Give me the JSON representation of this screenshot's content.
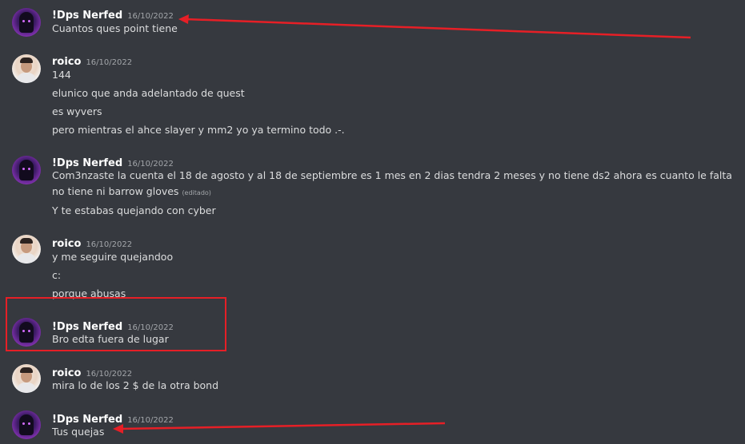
{
  "messages": [
    {
      "author": "!Dps Nerfed",
      "timestamp": "16/10/2022",
      "lines": [
        "Cuantos ques point tiene"
      ]
    },
    {
      "author": "roico",
      "timestamp": "16/10/2022",
      "lines": [
        "144",
        "elunico que anda adelantado de quest",
        "es wyvers",
        "pero mientras el ahce slayer y mm2 yo ya termino todo .-."
      ]
    },
    {
      "author": "!Dps Nerfed",
      "timestamp": "16/10/2022",
      "lines": [
        "Com3nzaste la cuenta el 18 de agosto y al 18 de septiembre es 1 mes en 2 dias tendra 2 meses y no  tiene ds2 ahora es cuanto le falta no tiene ni barrow gloves",
        "Y te estabas quejando con cyber"
      ],
      "edited_label": "(editado)"
    },
    {
      "author": "roico",
      "timestamp": "16/10/2022",
      "lines": [
        "y me seguire quejandoo",
        "c:",
        "porque abusas"
      ]
    },
    {
      "author": "!Dps Nerfed",
      "timestamp": "16/10/2022",
      "lines": [
        "Bro edta fuera de lugar"
      ]
    },
    {
      "author": "roico",
      "timestamp": "16/10/2022",
      "lines": [
        "mira lo de los 2 $ de la otra bond"
      ]
    },
    {
      "author": "!Dps Nerfed",
      "timestamp": "16/10/2022",
      "lines": [
        "Tus quejas"
      ]
    }
  ],
  "annotation_color": "#e61f26",
  "icons": {
    "dps_avatar": "hooded-figure-avatar-icon",
    "roico_avatar": "user-photo-avatar-icon"
  }
}
